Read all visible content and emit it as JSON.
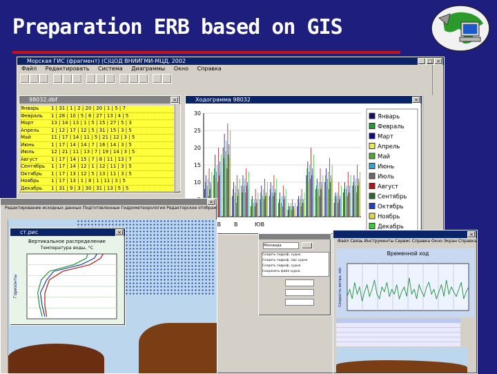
{
  "slide": {
    "title": "Preparation ERB based on GIS"
  },
  "app": {
    "window_title": "Морская ГИС (фрагмент)    (C)ЦОД ВНИИГМИ-МЦД, 2002",
    "menu": [
      "Файл",
      "Редактировать",
      "Система",
      "Диаграммы",
      "Окно",
      "Справка"
    ]
  },
  "table_window": {
    "title": "98032.dbf",
    "rows": [
      {
        "month": "Январь",
        "cells": "1 | 31 | 1 | 2 | 20 | 20 | 1 | 5 | 7"
      },
      {
        "month": "Февраль",
        "cells": "1 | 28 | 10 | 5 | 6 | 27 | 13 | 4 | 5"
      },
      {
        "month": "Март",
        "cells": "13 | 14 | 13 | 1 | 5 | 15 | 27 | 5 | 3"
      },
      {
        "month": "Апрель",
        "cells": "1 | 12 | 17 | 12 | 5 | 31 | 15 | 3 | 5"
      },
      {
        "month": "Май",
        "cells": "11 | 17 | 14 | 11 | 5 | 21 | 12 | 3 | 5"
      },
      {
        "month": "Июнь",
        "cells": "1 | 17 | 14 | 14 | 7 | 16 | 14 | 3 | 5"
      },
      {
        "month": "Июль",
        "cells": "12 | 21 | 11 | 13 | 7 | 19 | 14 | 3 | 5"
      },
      {
        "month": "Август",
        "cells": "1 | 17 | 14 | 15 | 7 | 8 | 11 | 13 | 7"
      },
      {
        "month": "Сентябрь",
        "cells": "1 | 17 | 14 | 12 | 1 | 12 | 11 | 3 | 5"
      },
      {
        "month": "Октябрь",
        "cells": "1 | 17 | 13 | 12 | 5 | 13 | 11 | 3 | 5"
      },
      {
        "month": "Ноябрь",
        "cells": "1 | 17 | 13 | 1 | 8 | 1 | 11 | 3 | 5"
      },
      {
        "month": "Декабрь",
        "cells": "1 | 31 | 9 | 3 | 30 | 31 | 13 | 5 | 5"
      }
    ]
  },
  "bar_window": {
    "title": "Ходограмма 98032",
    "x_labels": [
      "СВ",
      "В",
      "ЮВ"
    ]
  },
  "map_window": {
    "menu": "Редактирование исходных данных   Подготовленные   Гидрометеорология   Редакторское отображение   Окно   Вспомогательные   Справка"
  },
  "profile_window": {
    "title": "ст.рис"
  },
  "dialog": {
    "items": [
      "Москвада",
      "Создать гидроф. судно",
      "Создать гидроф. лдс судно",
      "Создать гидроф. судна",
      "Сохранить файл судна"
    ]
  },
  "series_window": {
    "menu": "Файл   Связь   Инструменты   Сервис   Справка   Окно   Экран   Справка",
    "y_label": "Скорость ветра, м/с"
  },
  "chart_data": [
    {
      "type": "bar",
      "title": "",
      "ylim": [
        0,
        30
      ],
      "y_ticks": [
        0,
        5,
        10,
        15,
        20,
        25,
        30
      ],
      "legend_position": "right",
      "series": [
        {
          "name": "Январь",
          "color": "#101060"
        },
        {
          "name": "Февраль",
          "color": "#1c9e35"
        },
        {
          "name": "Март",
          "color": "#0a0a8a"
        },
        {
          "name": "Апрель",
          "color": "#e8e85a"
        },
        {
          "name": "Май",
          "color": "#4aa83a"
        },
        {
          "name": "Июнь",
          "color": "#2aa8d8"
        },
        {
          "name": "Июль",
          "color": "#6a6a6a"
        },
        {
          "name": "Август",
          "color": "#aa1818"
        },
        {
          "name": "Сентябрь",
          "color": "#2a6a2a"
        },
        {
          "name": "Октябрь",
          "color": "#2040c8"
        },
        {
          "name": "Ноябрь",
          "color": "#d9d94a"
        },
        {
          "name": "Декабрь",
          "color": "#3cc83c"
        }
      ],
      "values": [
        [
          8,
          12,
          20,
          6,
          9,
          3,
          5,
          6,
          4,
          2,
          3,
          12,
          8,
          10,
          4,
          7,
          9
        ],
        [
          10,
          14,
          17,
          8,
          7,
          5,
          7,
          8,
          5,
          4,
          5,
          14,
          9,
          12,
          6,
          8,
          10
        ],
        [
          12,
          18,
          24,
          10,
          12,
          6,
          9,
          10,
          7,
          3,
          6,
          16,
          11,
          14,
          7,
          10,
          12
        ],
        [
          7,
          11,
          15,
          5,
          8,
          3,
          4,
          5,
          3,
          2,
          4,
          10,
          7,
          9,
          5,
          6,
          8
        ],
        [
          9,
          13,
          19,
          7,
          9,
          4,
          6,
          7,
          4,
          3,
          5,
          13,
          8,
          11,
          6,
          8,
          9
        ],
        [
          11,
          15,
          22,
          9,
          11,
          5,
          8,
          9,
          6,
          4,
          6,
          15,
          10,
          13,
          7,
          9,
          11
        ],
        [
          6,
          10,
          14,
          4,
          7,
          3,
          5,
          6,
          3,
          2,
          3,
          11,
          6,
          8,
          4,
          6,
          7
        ],
        [
          14,
          20,
          27,
          12,
          14,
          8,
          11,
          12,
          9,
          5,
          8,
          20,
          14,
          17,
          10,
          13,
          15
        ],
        [
          8,
          12,
          18,
          6,
          9,
          4,
          6,
          7,
          5,
          3,
          4,
          12,
          8,
          10,
          5,
          7,
          9
        ],
        [
          10,
          16,
          21,
          8,
          10,
          5,
          7,
          8,
          6,
          3,
          5,
          14,
          10,
          12,
          6,
          9,
          11
        ],
        [
          9,
          13,
          17,
          7,
          8,
          4,
          6,
          7,
          5,
          2,
          4,
          12,
          9,
          11,
          5,
          7,
          10
        ],
        [
          13,
          18,
          25,
          11,
          13,
          7,
          10,
          11,
          8,
          4,
          7,
          18,
          12,
          15,
          9,
          12,
          13
        ]
      ]
    },
    {
      "type": "line",
      "title": "Вертикальное распределение",
      "subtitle": "Температура воды, °С",
      "ylabel": "Горизонты",
      "xlim": [
        -2,
        8
      ],
      "ylim": [
        0,
        300
      ],
      "series": [
        {
          "name": "",
          "x": [
            6.5,
            6.2,
            5.0,
            2.0,
            0.5,
            0.0,
            0.0,
            0.2
          ],
          "y": [
            0,
            20,
            50,
            80,
            120,
            180,
            240,
            290
          ]
        },
        {
          "name": "",
          "x": [
            5.8,
            5.5,
            4.0,
            1.0,
            0.2,
            -0.5,
            -0.3,
            0.0
          ],
          "y": [
            0,
            20,
            50,
            80,
            120,
            180,
            240,
            290
          ]
        },
        {
          "name": "",
          "x": [
            4.8,
            4.6,
            3.2,
            0.5,
            -0.4,
            -0.8,
            -0.6,
            -0.3
          ],
          "y": [
            0,
            20,
            50,
            80,
            120,
            180,
            240,
            290
          ]
        }
      ]
    },
    {
      "type": "line",
      "title": "Временной ход",
      "ylabel": "Скорость ветра, м/с",
      "ylim": [
        0,
        20
      ],
      "series": [
        {
          "name": "",
          "values": [
            6,
            9,
            5,
            12,
            7,
            10,
            4,
            8,
            11,
            6,
            9,
            13,
            7,
            5,
            10,
            8,
            12,
            6,
            9,
            7,
            11,
            5,
            8,
            10,
            6,
            14,
            7,
            9,
            5,
            11,
            8,
            6,
            10,
            12,
            7,
            9,
            5,
            8,
            11,
            6,
            13,
            7,
            10,
            8,
            6,
            9,
            12,
            5,
            8,
            10
          ]
        }
      ]
    }
  ]
}
